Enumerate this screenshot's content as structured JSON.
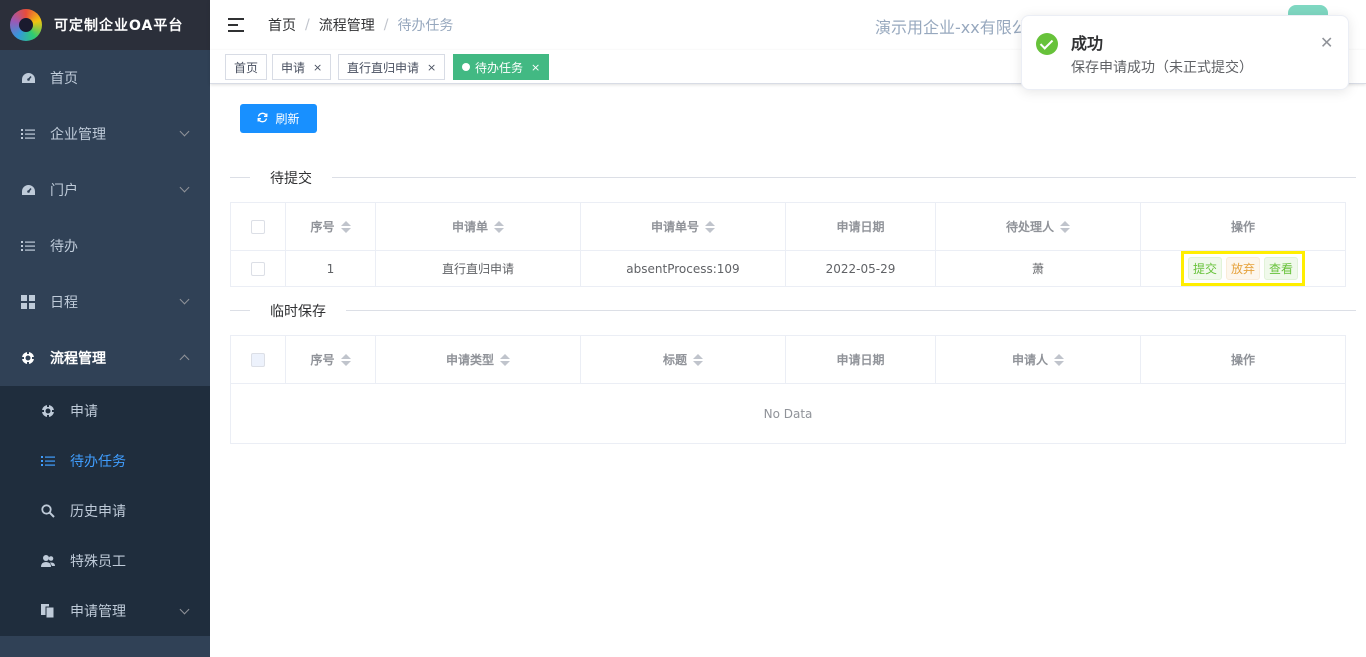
{
  "app": {
    "title": "可定制企业OA平台"
  },
  "sidebar": {
    "items": [
      {
        "label": "首页",
        "icon": "dashboard-icon"
      },
      {
        "label": "企业管理",
        "icon": "list-icon"
      },
      {
        "label": "门户",
        "icon": "dashboard-icon"
      },
      {
        "label": "待办",
        "icon": "list-icon"
      },
      {
        "label": "日程",
        "icon": "grid-icon"
      },
      {
        "label": "流程管理",
        "icon": "settings-icon"
      }
    ],
    "subitems": [
      {
        "label": "申请",
        "icon": "settings-icon"
      },
      {
        "label": "待办任务",
        "icon": "list-icon"
      },
      {
        "label": "历史申请",
        "icon": "search-icon"
      },
      {
        "label": "特殊员工",
        "icon": "users-icon"
      },
      {
        "label": "申请管理",
        "icon": "copy-icon"
      }
    ]
  },
  "navbar": {
    "breadcrumb": [
      "首页",
      "流程管理",
      "待办任务"
    ],
    "company": "演示用企业-xx有限公"
  },
  "tags": [
    {
      "label": "首页",
      "closable": false
    },
    {
      "label": "申请",
      "closable": true
    },
    {
      "label": "直行直归申请",
      "closable": true
    },
    {
      "label": "待办任务",
      "closable": true,
      "active": true
    }
  ],
  "main": {
    "refresh_label": "刷新",
    "section1": {
      "title": "待提交",
      "headers": [
        "序号",
        "申请单",
        "申请单号",
        "申请日期",
        "待处理人",
        "操作"
      ],
      "rows": [
        {
          "index": "1",
          "form": "直行直归申请",
          "number": "absentProcess:109",
          "date": "2022-05-29",
          "handler": "萧"
        }
      ],
      "ops": {
        "submit": "提交",
        "abandon": "放弃",
        "view": "查看"
      }
    },
    "section2": {
      "title": "临时保存",
      "headers": [
        "序号",
        "申请类型",
        "标题",
        "申请日期",
        "申请人",
        "操作"
      ],
      "empty_text": "No Data"
    }
  },
  "notification": {
    "title": "成功",
    "message": "保存申请成功（未正式提交）"
  },
  "colors": {
    "sidebar_bg": "#304156",
    "active_tag": "#42b983",
    "primary": "#1890ff",
    "success": "#67c23a",
    "warning": "#e6a23c",
    "highlight": "#ffee00"
  }
}
